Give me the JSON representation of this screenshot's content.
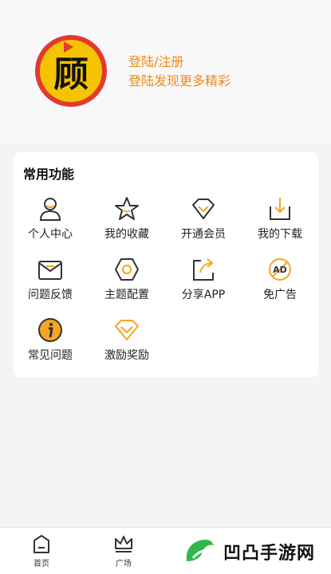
{
  "header": {
    "logo_char": "顾",
    "login_link": "登陆/注册",
    "login_subtitle": "登陆发现更多精彩"
  },
  "card": {
    "title": "常用功能",
    "items": [
      {
        "label": "个人中心",
        "icon": "user-icon"
      },
      {
        "label": "我的收藏",
        "icon": "star-icon"
      },
      {
        "label": "开通会员",
        "icon": "vip-icon"
      },
      {
        "label": "我的下载",
        "icon": "download-icon"
      },
      {
        "label": "问题反馈",
        "icon": "feedback-icon"
      },
      {
        "label": "主题配置",
        "icon": "theme-icon"
      },
      {
        "label": "分享APP",
        "icon": "share-icon"
      },
      {
        "label": "免广告",
        "icon": "no-ads-icon"
      },
      {
        "label": "常见问题",
        "icon": "info-icon"
      },
      {
        "label": "激励奖励",
        "icon": "diamond-icon"
      }
    ]
  },
  "tabbar": {
    "tabs": [
      {
        "label": "首页",
        "icon": "home-icon"
      },
      {
        "label": "广场",
        "icon": "crown-icon"
      }
    ]
  },
  "watermark": {
    "text": "凹凸手游网"
  },
  "colors": {
    "accent": "#f08a12",
    "icon_orange": "#f5a623",
    "logo_red": "#e23a2e",
    "logo_yellow": "#f5c400"
  }
}
